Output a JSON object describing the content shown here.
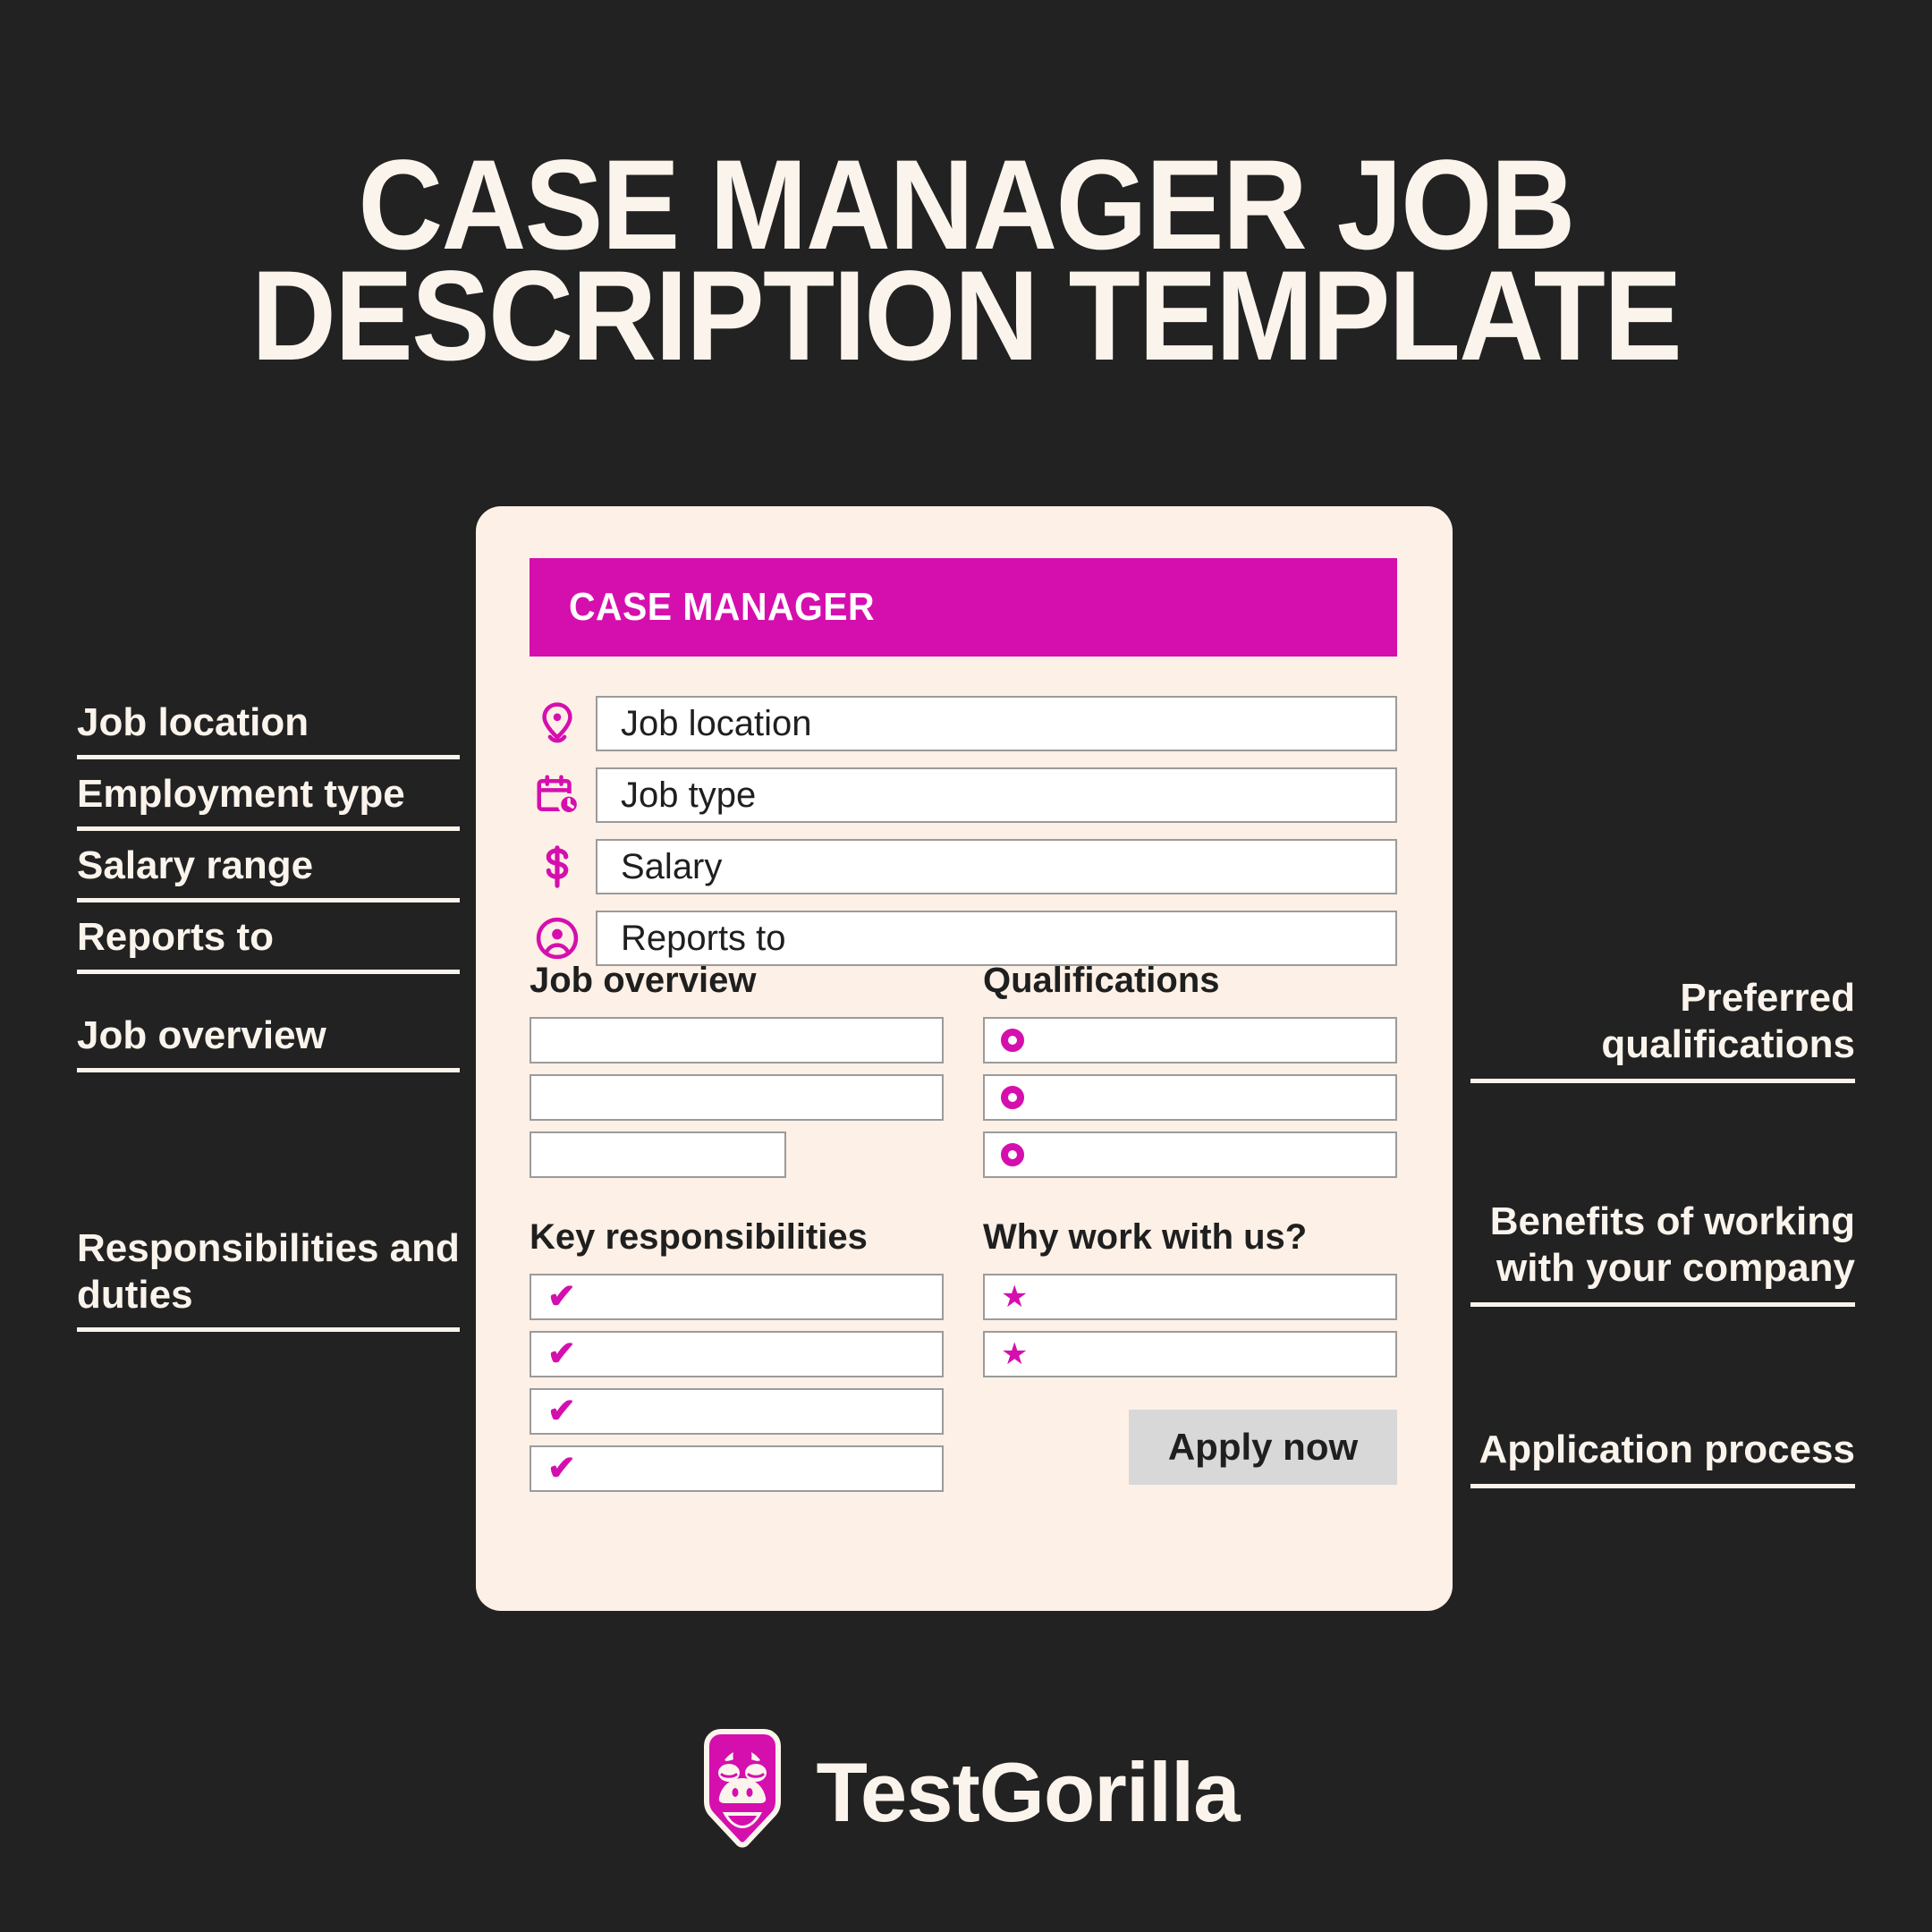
{
  "title": {
    "line1": "CASE MANAGER JOB",
    "line2": "DESCRIPTION TEMPLATE"
  },
  "colors": {
    "background": "#222222",
    "card": "#FDF0E6",
    "accent_magenta": "#D50FAE",
    "cream_text": "#FBF4EC",
    "field_border": "#9B9B9B",
    "button_gray": "#D8D8D8"
  },
  "annotations_left": [
    {
      "label": "Job location"
    },
    {
      "label": "Employment type"
    },
    {
      "label": "Salary range"
    },
    {
      "label": "Reports to"
    },
    {
      "label": "Job overview"
    },
    {
      "label": "Responsibilities and duties"
    }
  ],
  "annotations_right": [
    {
      "label": "Preferred qualifications"
    },
    {
      "label": "Benefits of working with your company"
    },
    {
      "label": "Application process"
    }
  ],
  "card": {
    "header_title": "CASE MANAGER",
    "top_fields": [
      {
        "icon": "location-pin-icon",
        "value": "Job location"
      },
      {
        "icon": "calendar-clock-icon",
        "value": "Job type"
      },
      {
        "icon": "dollar-sign-icon",
        "value": "Salary"
      },
      {
        "icon": "person-circle-icon",
        "value": "Reports to"
      }
    ],
    "sections": {
      "job_overview": {
        "title": "Job overview",
        "rows": [
          "",
          "",
          ""
        ]
      },
      "qualifications": {
        "title": "Qualifications",
        "marker": "ring-bullet-icon",
        "rows": [
          "",
          "",
          ""
        ]
      },
      "key_responsibilities": {
        "title": "Key responsibilities",
        "marker": "check-icon",
        "rows": [
          "",
          "",
          "",
          ""
        ]
      },
      "why_work_with_us": {
        "title": "Why work with us?",
        "marker": "star-icon",
        "rows": [
          "",
          ""
        ]
      }
    },
    "apply_button": "Apply now"
  },
  "footer": {
    "brand": "TestGorilla",
    "logo_icon": "gorilla-shield-logo"
  }
}
